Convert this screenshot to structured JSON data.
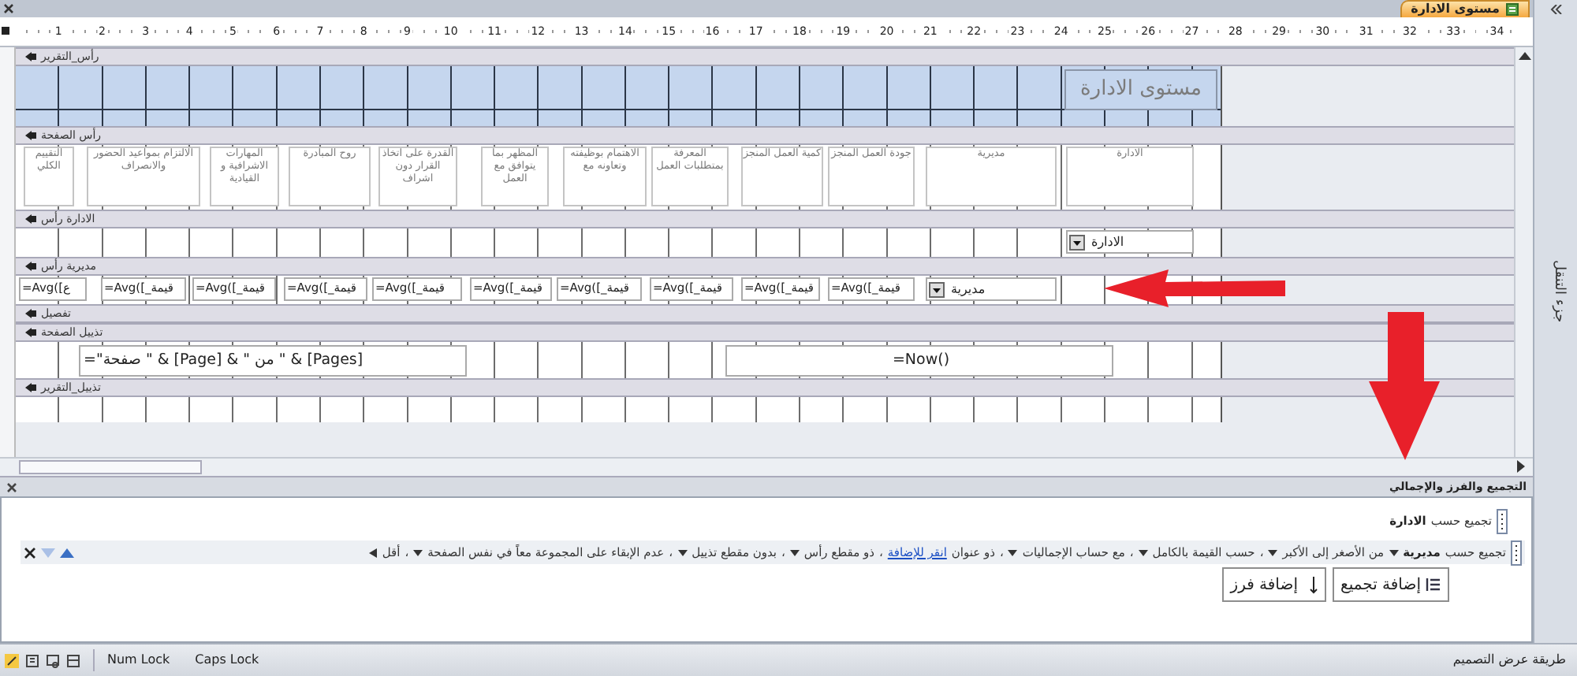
{
  "document_tab": {
    "title": "مستوى الادارة",
    "selected": true
  },
  "ruler": [
    "34",
    "33",
    "32",
    "31",
    "30",
    "29",
    "28",
    "27",
    "26",
    "25",
    "24",
    "23",
    "22",
    "21",
    "20",
    "19",
    "18",
    "17",
    "16",
    "15",
    "14",
    "13",
    "12",
    "11",
    "10",
    "9",
    "8",
    "7",
    "6",
    "5",
    "4",
    "3",
    "2",
    "1"
  ],
  "sections": [
    {
      "kind": "report_header",
      "label": "رأس_التقرير",
      "title_label": "مستوى الادارة"
    },
    {
      "kind": "page_header",
      "label": "رأس الصفحة",
      "column_labels": [
        "الادارة",
        "مديرية",
        "جودة العمل المنجز",
        "كمية العمل المنجز",
        "المعرفة بمتطلبات العمل",
        "الاهتمام بوظيفته وتعاونه مع",
        "المظهر بما يتوافق مع العمل",
        "القدرة على اتخاذ القرار دون اشراف",
        "روح المبادرة",
        "المهارات الاشرافية و القيادية",
        "الالتزام بمواعيد الحضور والانصراف",
        "التقييم الكلي"
      ]
    },
    {
      "kind": "group_header",
      "label": "الادارة رأس",
      "combo": "الادارة"
    },
    {
      "kind": "group_header",
      "label": "مديرية رأس",
      "combo": "مديرية",
      "formulas": [
        "=Avg([_قيمة",
        "=Avg([_قيمة",
        "=Avg([_قيمة",
        "=Avg([_قيمة",
        "=Avg([_قيمة",
        "=Avg([_قيمة",
        "=Avg([_قيمة",
        "=Avg([_قيمة",
        "=Avg([_قيمة",
        "=Avg([ع"
      ]
    },
    {
      "kind": "detail",
      "label": "تفصيل"
    },
    {
      "kind": "page_footer",
      "label": "تذييل الصفحة",
      "text_boxes": [
        "=Now()",
        "=\"صفحة \" & [Page] & \" من \" & [Pages]"
      ]
    },
    {
      "kind": "report_footer",
      "label": "تذييل_التقرير"
    }
  ],
  "navigation_pane": {
    "title": "جزء التنقل"
  },
  "group_pane": {
    "title": "التجميع والفرز والإجمالي",
    "separator": "،",
    "levels": [
      {
        "prefix": "تجميع حسب",
        "field": "الادارة",
        "expanded": false
      },
      {
        "prefix": "تجميع حسب",
        "field": "مديرية",
        "expanded": true,
        "less": "أقل",
        "options": [
          {
            "text": "من الأصغر إلى الأكبر",
            "kind": "dropdown"
          },
          {
            "text": "حسب القيمة بالكامل",
            "kind": "dropdown"
          },
          {
            "text": "مع حساب الإجماليات",
            "kind": "dropdown"
          },
          {
            "text": "ذو عنوان",
            "link": "انقر للإضافة",
            "kind": "link"
          },
          {
            "text": "ذو مقطع رأس",
            "kind": "dropdown"
          },
          {
            "text": "بدون مقطع تذييل",
            "kind": "dropdown"
          },
          {
            "text": "عدم الإبقاء على المجموعة معاً في نفس الصفحة",
            "kind": "dropdown"
          }
        ]
      }
    ],
    "buttons": [
      {
        "label": "إضافة تجميع",
        "kind": "group"
      },
      {
        "label": "إضافة فرز",
        "kind": "sort"
      }
    ]
  },
  "status_bar": {
    "keys": [
      "Caps Lock",
      "Num Lock"
    ],
    "view": "طريقة عرض التصميم"
  }
}
